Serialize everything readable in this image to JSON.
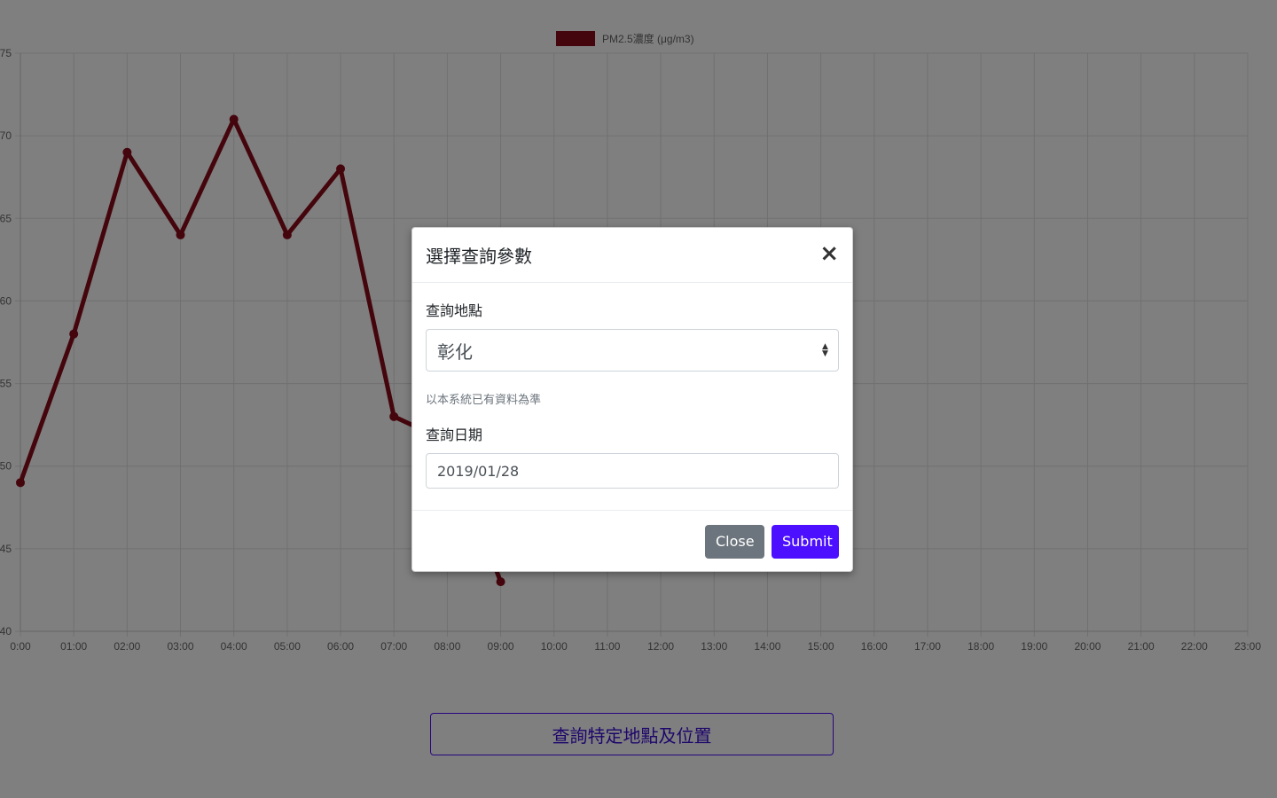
{
  "chart_data": {
    "type": "line",
    "series": [
      {
        "name": "PM2.5濃度 (μg/m3)",
        "color": "#8b0a1a",
        "x": [
          "0:00",
          "01:00",
          "02:00",
          "03:00",
          "04:00",
          "05:00",
          "06:00",
          "07:00",
          "08:00",
          "09:00"
        ],
        "values": [
          49,
          58,
          69,
          64,
          71,
          64,
          68,
          53,
          51.5,
          43
        ]
      }
    ],
    "x_tick_labels": [
      "0:00",
      "01:00",
      "02:00",
      "03:00",
      "04:00",
      "05:00",
      "06:00",
      "07:00",
      "08:00",
      "09:00",
      "10:00",
      "11:00",
      "12:00",
      "13:00",
      "14:00",
      "15:00",
      "16:00",
      "17:00",
      "18:00",
      "19:00",
      "20:00",
      "21:00",
      "22:00",
      "23:00"
    ],
    "y_tick_labels": [
      "75",
      "70",
      "65",
      "60",
      "55",
      "50",
      "45",
      "40"
    ],
    "ylim": [
      40,
      75
    ],
    "grid": true,
    "legend_position": "top-center"
  },
  "page": {
    "query_button_label": "查詢特定地點及位置"
  },
  "modal": {
    "title": "選擇查詢參數",
    "close_icon": "×",
    "location_label": "查詢地點",
    "location_value": "彰化",
    "location_help": "以本系統已有資料為準",
    "date_label": "查詢日期",
    "date_value": "2019/01/28",
    "close_label": "Close",
    "submit_label": "Submit"
  },
  "colors": {
    "accent": "#4c0fff",
    "secondary_button": "#6c757d",
    "series_line": "#8b0a1a"
  }
}
